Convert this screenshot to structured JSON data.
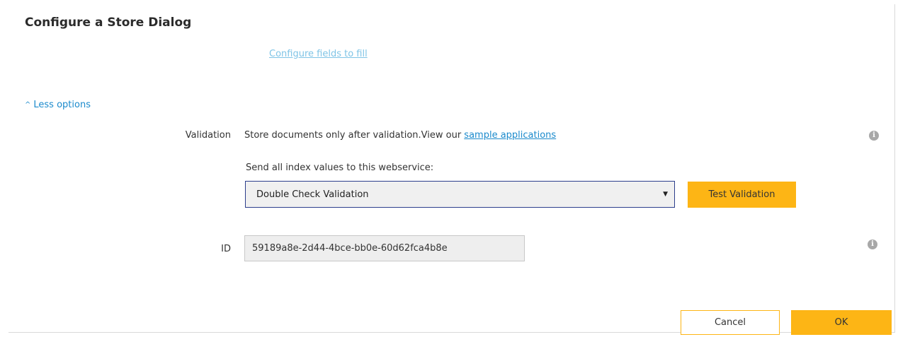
{
  "dialog": {
    "title": "Configure a Store Dialog",
    "configure_link": "Configure fields to fill",
    "less_options": "Less options",
    "chevron_icon": "chevron-up-icon"
  },
  "validation": {
    "label": "Validation",
    "text": "Store documents only after validation.View our ",
    "link": "sample applications",
    "send_text": "Send all index values to this webservice:",
    "selected": "Double Check Validation",
    "test_button": "Test Validation",
    "info_icon": "info-icon"
  },
  "id_field": {
    "label": "ID",
    "value": "59189a8e-2d44-4bce-bb0e-60d62fca4b8e",
    "info_icon": "info-icon"
  },
  "footer": {
    "cancel": "Cancel",
    "ok": "OK"
  },
  "colors": {
    "accent": "#fdb515",
    "link": "#1b8acc",
    "link_light": "#7fc4e6",
    "select_border": "#2c3e8c"
  }
}
